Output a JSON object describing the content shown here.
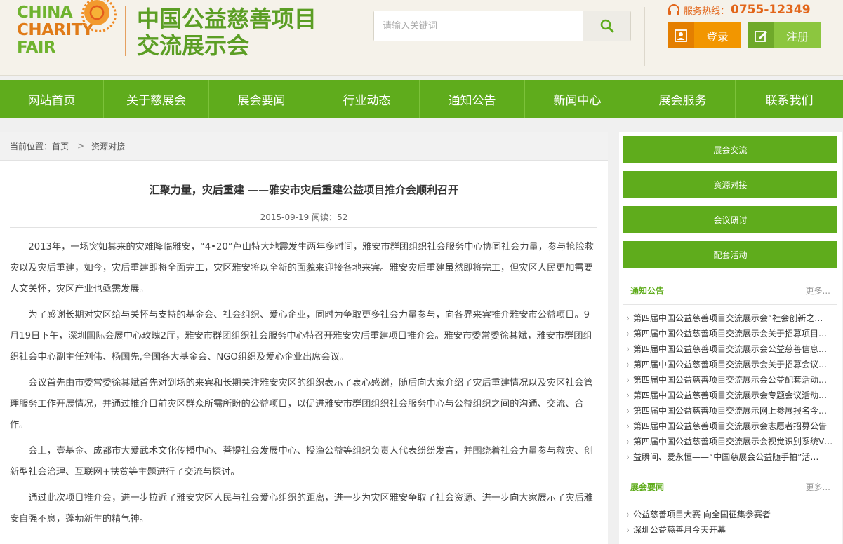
{
  "header": {
    "logo_en_line1": "CHINA",
    "logo_en_line2": "CHARITY",
    "logo_en_line3": "FAIR",
    "logo_cn_line1": "中国公益慈善项目",
    "logo_cn_line2": "交流展示会",
    "search_placeholder": "请输入关键词",
    "hotline_label": "服务热线：",
    "hotline_number": "0755-12349",
    "login_label": "登录",
    "register_label": "注册"
  },
  "nav": {
    "items": [
      "网站首页",
      "关于慈展会",
      "展会要闻",
      "行业动态",
      "通知公告",
      "新闻中心",
      "展会服务",
      "联系我们"
    ]
  },
  "breadcrumb": {
    "prefix": "当前位置：首页",
    "separator": ">",
    "current": "资源对接"
  },
  "article": {
    "title": "汇聚力量，灾后重建 ——雅安市灾后重建公益项目推介会顺利召开",
    "meta": "2015-09-19 阅读：52",
    "paragraphs": [
      "2013年，一场突如其来的灾难降临雅安，“4•20”芦山特大地震发生两年多时间，雅安市群团组织社会服务中心协同社会力量，参与抢险救灾以及灾后重建，如今，灾后重建即将全面完工，灾区雅安将以全新的面貌来迎接各地来宾。雅安灾后重建虽然即将完工，但灾区人民更加需要人文关怀，灾区产业也亟需发展。",
      "为了感谢长期对灾区给与关怀与支持的基金会、社会组织、爱心企业，同时为争取更多社会力量参与，向各界来宾推介雅安市公益项目。9月19日下午，深圳国际会展中心玫瑰2厅，雅安市群团组织社会服务中心特召开雅安灾后重建项目推介会。雅安市委常委徐其斌，雅安市群团组织社会中心副主任刘伟、杨国先,全国各大基金会、NGO组织及爱心企业出席会议。",
      "会议首先由市委常委徐其斌首先对到场的来宾和长期关注雅安灾区的组织表示了衷心感谢，随后向大家介绍了灾后重建情况以及灾区社会管理服务工作开展情况，并通过推介目前灾区群众所需所盼的公益项目，以促进雅安市群团组织社会服务中心与公益组织之间的沟通、交流、合作。",
      "会上，壹基金、成都市大爱武术文化传播中心、菩提社会发展中心、授渔公益等组织负责人代表纷纷发言，并围绕着社会力量参与救灾、创新型社会治理、互联网+扶贫等主题进行了交流与探讨。",
      "通过此次项目推介会，进一步拉近了雅安灾区人民与社会爱心组织的距离，进一步为灾区雅安争取了社会资源、进一步向大家展示了灾后雅安自强不息，蓬勃新生的精气神。"
    ]
  },
  "sidebar": {
    "buttons": [
      "展会交流",
      "资源对接",
      "会议研讨",
      "配套活动"
    ],
    "notice_title": "通知公告",
    "notice_more": "更多...",
    "notice_items": [
      "第四届中国公益慈善项目交流展示会“社会创新之…",
      "第四届中国公益慈善项目交流展示会关于招募项目…",
      "第四届中国公益慈善项目交流展示会公益慈善信息…",
      "第四届中国公益慈善项目交流展示会关于招募会议…",
      "第四届中国公益慈善项目交流展示会公益配套活动…",
      "第四届中国公益慈善项目交流展示会专题会议活动…",
      "第四届中国公益慈善项目交流展示网上参展报名今…",
      "第四届中国公益慈善项目交流展示会志愿者招募公告",
      "第四届中国公益慈善项目交流展示会视觉识别系统V…",
      "益瞬间、爱永恒——“中国慈展会公益随手拍”活…"
    ],
    "news_title": "展会要闻",
    "news_more": "更多...",
    "news_items": [
      "公益慈善项目大赛 向全国征集参赛者",
      "深圳公益慈善月今天开幕"
    ]
  }
}
